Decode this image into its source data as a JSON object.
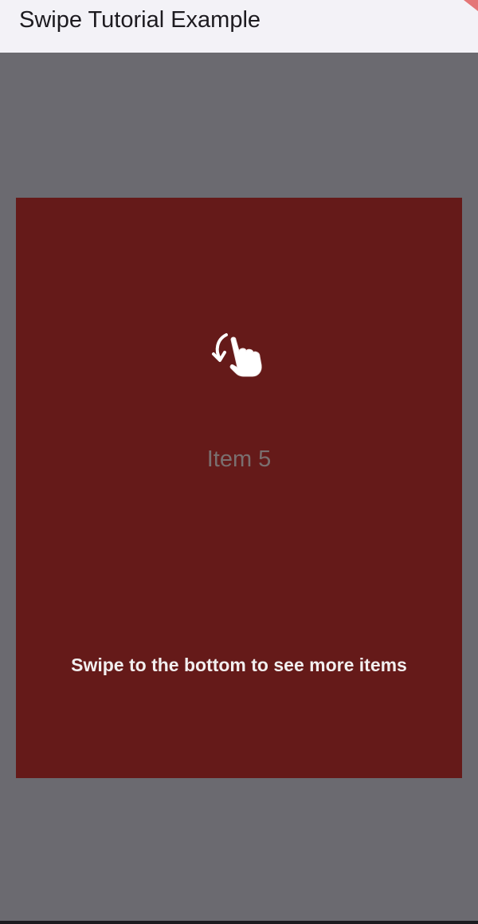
{
  "app_bar": {
    "title": "Swipe Tutorial Example"
  },
  "card": {
    "item_label": "Item 5",
    "background": "#651a19"
  },
  "tutorial": {
    "icon": "swipe-down-hand-icon",
    "message": "Swipe to the bottom to see more items"
  },
  "colors": {
    "overlay": "#6b6a70",
    "app_bar_background": "#f3f2f7",
    "title_text": "#1d1b20"
  }
}
